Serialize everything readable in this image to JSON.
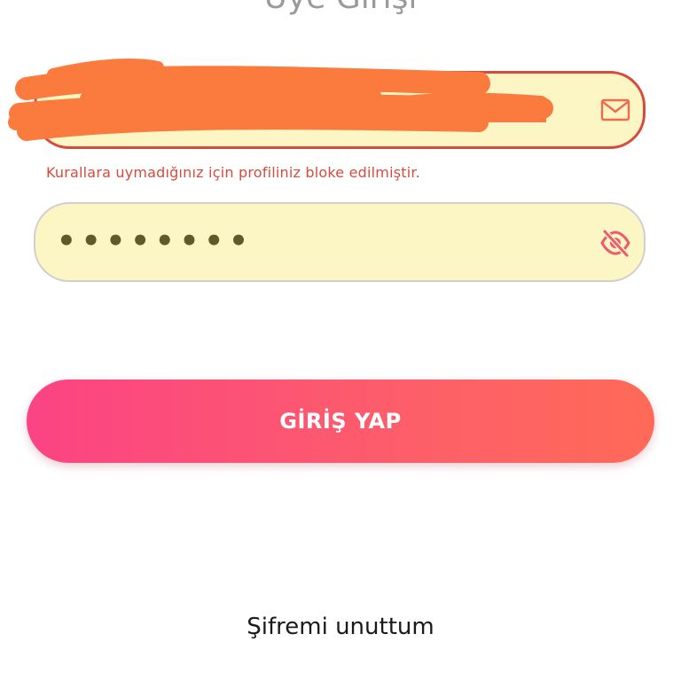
{
  "header": {
    "title": "Üye Girişi"
  },
  "email": {
    "value": "",
    "icon": "mail-icon"
  },
  "error": {
    "message": "Kurallara uymadığınız için profiliniz bloke edilmiştir."
  },
  "password": {
    "value": "••••••••",
    "icon": "eye-slash-icon"
  },
  "login_button": {
    "label": "GİRİŞ YAP"
  },
  "forgot_password": {
    "label": "Şifremi unuttum"
  },
  "colors": {
    "accent_start": "#fb4384",
    "accent_end": "#ff6a58",
    "error": "#d94a3c",
    "field_background": "#fbf6c4",
    "scribble": "#fb7a3e"
  }
}
